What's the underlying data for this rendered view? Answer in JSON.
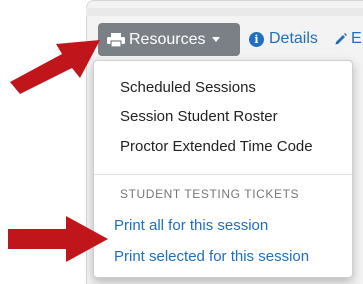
{
  "toolbar": {
    "resources_label": "Resources",
    "details_label": "Details",
    "extra_label": "E",
    "icons": {
      "resources": "print-icon",
      "resources_caret": "caret-down-icon",
      "details": "info-icon",
      "extra": "pencil-icon"
    }
  },
  "menu": {
    "items": [
      {
        "label": "Scheduled Sessions"
      },
      {
        "label": "Session Student Roster"
      },
      {
        "label": "Proctor Extended Time Code"
      }
    ],
    "section_header": "STUDENT TESTING TICKETS",
    "links": [
      {
        "label": "Print all for this session"
      },
      {
        "label": "Print selected for this session"
      }
    ]
  },
  "colors": {
    "button_bg": "#7b8087",
    "link": "#1f6fc0",
    "arrow": "#c0161b"
  }
}
